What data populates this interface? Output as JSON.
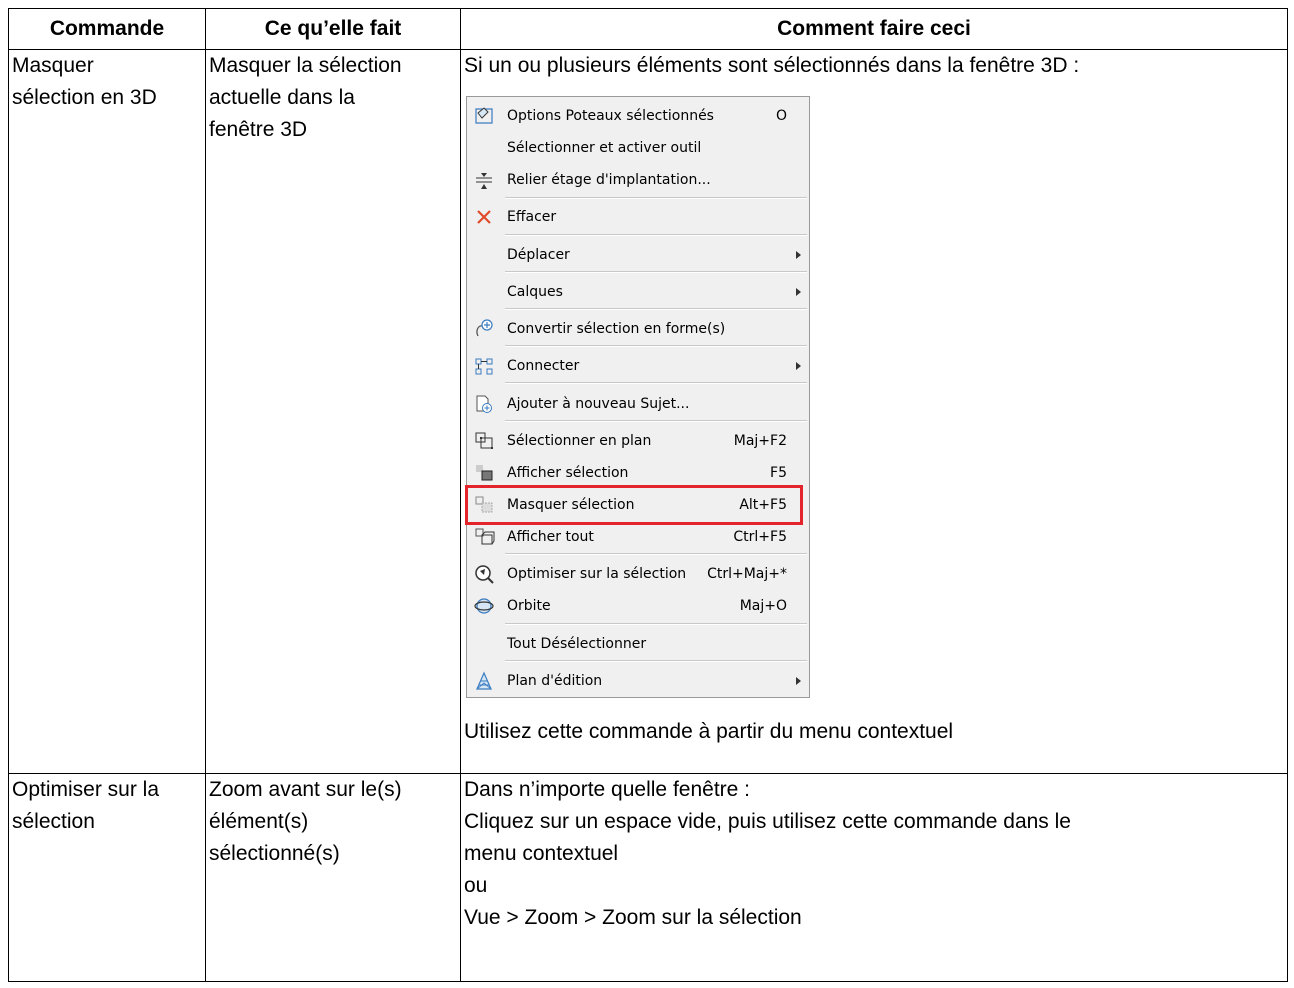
{
  "headers": [
    "Commande",
    "Ce qu’elle fait",
    "Comment faire ceci"
  ],
  "rows": [
    {
      "command": "Masquer\nsélection en 3D",
      "what": "Masquer la sélection\nactuelle dans la\nfenêtre 3D",
      "intro": "Si un ou plusieurs éléments sont sélectionnés dans la fenêtre 3D :",
      "footer": "Utilisez cette commande à partir du menu contextuel"
    },
    {
      "command": "Optimiser sur la\nsélection",
      "what": "Zoom avant sur le(s)\nélément(s)\nsélectionné(s)",
      "how": [
        "Dans n’importe quelle fenêtre :",
        "Cliquez sur un espace vide, puis utilisez cette commande dans le",
        "menu contextuel",
        "ou",
        "Vue > Zoom > Zoom sur la sélection"
      ]
    }
  ],
  "menu": {
    "highlight_color": "#e3242b",
    "items": [
      {
        "label": "Options Poteaux sélectionnés",
        "shortcut": "O",
        "icon": "column-settings-icon"
      },
      {
        "label": "Sélectionner et activer outil",
        "shortcut": "",
        "icon": ""
      },
      {
        "label": "Relier étage d'implantation...",
        "shortcut": "",
        "icon": "home-story-icon"
      },
      {
        "label": "Effacer",
        "shortcut": "",
        "icon": "delete-x-icon"
      },
      {
        "label": "Déplacer",
        "shortcut": "",
        "icon": "",
        "submenu": true
      },
      {
        "label": "Calques",
        "shortcut": "",
        "icon": "",
        "submenu": true
      },
      {
        "label": "Convertir sélection en forme(s)",
        "shortcut": "",
        "icon": "convert-to-morph-icon"
      },
      {
        "label": "Connecter",
        "shortcut": "",
        "icon": "connect-icon",
        "submenu": true
      },
      {
        "label": "Ajouter à nouveau Sujet...",
        "shortcut": "",
        "icon": "add-issue-icon"
      },
      {
        "label": "Sélectionner en plan",
        "shortcut": "Maj+F2",
        "icon": "select-in-plan-icon"
      },
      {
        "label": "Afficher sélection",
        "shortcut": "F5",
        "icon": "show-selection-icon"
      },
      {
        "label": "Masquer sélection",
        "shortcut": "Alt+F5",
        "icon": "hide-selection-icon"
      },
      {
        "label": "Afficher tout",
        "shortcut": "Ctrl+F5",
        "icon": "show-all-icon"
      },
      {
        "label": "Optimiser sur la sélection",
        "shortcut": "Ctrl+Maj+*",
        "icon": "zoom-to-selection-icon"
      },
      {
        "label": "Orbite",
        "shortcut": "Maj+O",
        "icon": "orbit-icon"
      },
      {
        "label": "Tout Désélectionner",
        "shortcut": "",
        "icon": ""
      },
      {
        "label": "Plan d'édition",
        "shortcut": "",
        "icon": "editing-plane-icon",
        "submenu": true
      }
    ]
  }
}
